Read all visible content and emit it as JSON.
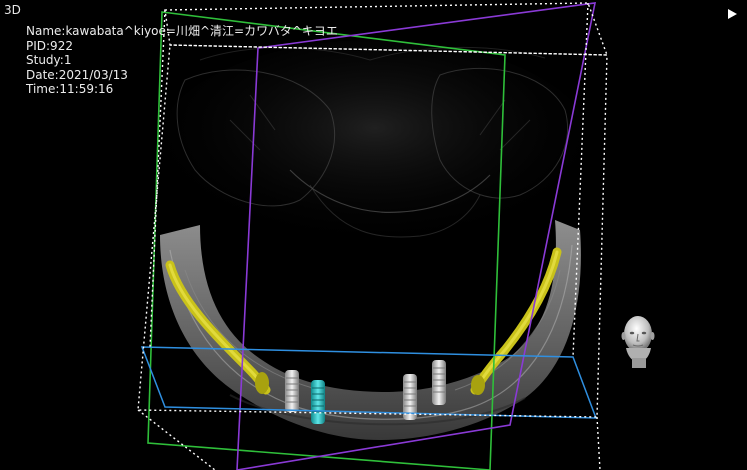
{
  "view": {
    "title": "3D"
  },
  "patient_info": {
    "name": "Name:kawabata^kiyoe=川畑^清江=カワバタ^キヨエ",
    "pid": "PID:922",
    "study": "Study:1",
    "date": "Date:2021/03/13",
    "time": "Time:11:59:16"
  },
  "colors": {
    "background": "#000000",
    "nerve_canal": "#c9c21a",
    "implant_selected": "#27c6c9",
    "implant": "#d8d8d8",
    "bounding_box": "#ffffff",
    "plane_green": "#2fbf3a",
    "plane_purple": "#8a3ad6",
    "plane_blue": "#2f8fe0"
  },
  "icons": {
    "play": "play-triangle-icon",
    "orientation": "head-orientation-icon"
  }
}
